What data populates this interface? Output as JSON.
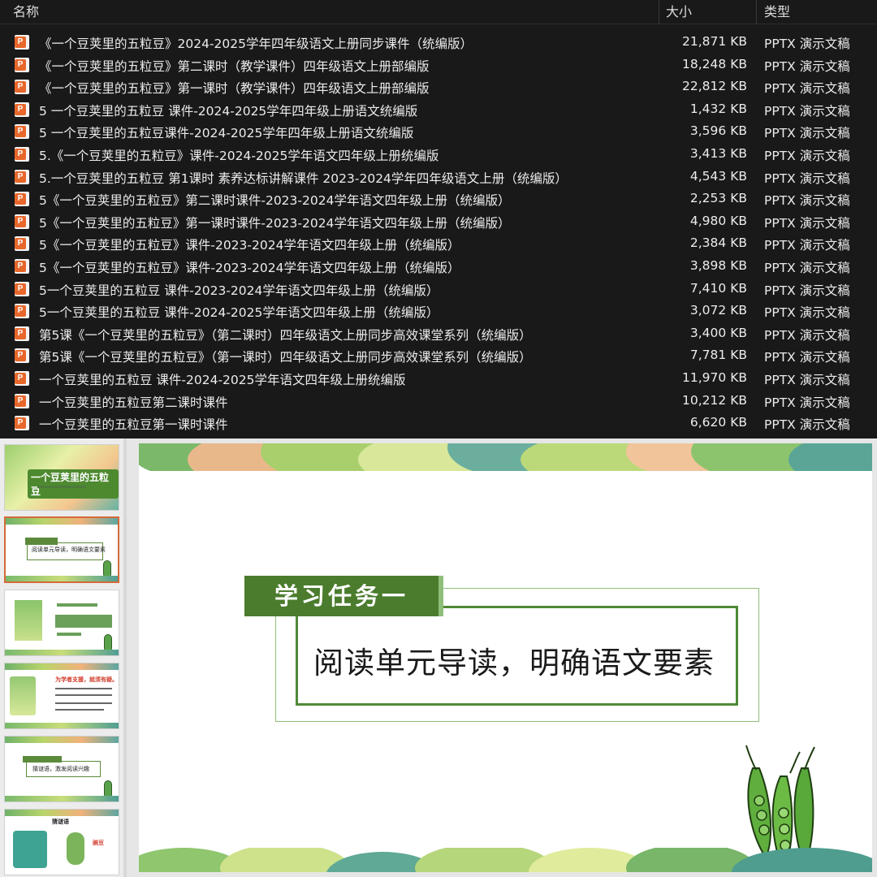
{
  "explorer": {
    "columns": {
      "name": "名称",
      "size": "大小",
      "type": "类型"
    },
    "file_icon": "pptx-file-icon",
    "file_icon_letter": "P",
    "files": [
      {
        "name": "《一个豆荚里的五粒豆》2024-2025学年四年级语文上册同步课件（统编版）",
        "size": "21,871 KB",
        "type": "PPTX 演示文稿"
      },
      {
        "name": "《一个豆荚里的五粒豆》第二课时（教学课件）四年级语文上册部编版",
        "size": "18,248 KB",
        "type": "PPTX 演示文稿"
      },
      {
        "name": "《一个豆荚里的五粒豆》第一课时（教学课件）四年级语文上册部编版",
        "size": "22,812 KB",
        "type": "PPTX 演示文稿"
      },
      {
        "name": "5 一个豆荚里的五粒豆 课件-2024-2025学年四年级上册语文统编版",
        "size": "1,432 KB",
        "type": "PPTX 演示文稿"
      },
      {
        "name": "5 一个豆荚里的五粒豆课件-2024-2025学年四年级上册语文统编版",
        "size": "3,596 KB",
        "type": "PPTX 演示文稿"
      },
      {
        "name": "5.《一个豆荚里的五粒豆》课件-2024-2025学年语文四年级上册统编版",
        "size": "3,413 KB",
        "type": "PPTX 演示文稿"
      },
      {
        "name": "5.一个豆荚里的五粒豆 第1课时 素养达标讲解课件 2023-2024学年四年级语文上册（统编版）",
        "size": "4,543 KB",
        "type": "PPTX 演示文稿"
      },
      {
        "name": "5《一个豆荚里的五粒豆》第二课时课件-2023-2024学年语文四年级上册（统编版）",
        "size": "2,253 KB",
        "type": "PPTX 演示文稿"
      },
      {
        "name": "5《一个豆荚里的五粒豆》第一课时课件-2023-2024学年语文四年级上册（统编版）",
        "size": "4,980 KB",
        "type": "PPTX 演示文稿"
      },
      {
        "name": "5《一个豆荚里的五粒豆》课件-2023-2024学年语文四年级上册（统编版）",
        "size": "2,384 KB",
        "type": "PPTX 演示文稿"
      },
      {
        "name": "5《一个豆荚里的五粒豆》课件-2023-2024学年语文四年级上册（统编版）",
        "size": "3,898 KB",
        "type": "PPTX 演示文稿"
      },
      {
        "name": "5一个豆荚里的五粒豆 课件-2023-2024学年语文四年级上册（统编版）",
        "size": "7,410 KB",
        "type": "PPTX 演示文稿"
      },
      {
        "name": "5一个豆荚里的五粒豆 课件-2024-2025学年语文四年级上册（统编版）",
        "size": "3,072 KB",
        "type": "PPTX 演示文稿"
      },
      {
        "name": "第5课《一个豆荚里的五粒豆》（第二课时）四年级语文上册同步高效课堂系列（统编版）",
        "size": "3,400 KB",
        "type": "PPTX 演示文稿"
      },
      {
        "name": "第5课《一个豆荚里的五粒豆》（第一课时）四年级语文上册同步高效课堂系列（统编版）",
        "size": "7,781 KB",
        "type": "PPTX 演示文稿"
      },
      {
        "name": "一个豆荚里的五粒豆 课件-2024-2025学年语文四年级上册统编版",
        "size": "11,970 KB",
        "type": "PPTX 演示文稿"
      },
      {
        "name": "一个豆荚里的五粒豆第二课时课件",
        "size": "10,212 KB",
        "type": "PPTX 演示文稿"
      },
      {
        "name": "一个豆荚里的五粒豆第一课时课件",
        "size": "6,620 KB",
        "type": "PPTX 演示文稿"
      }
    ]
  },
  "thumbnails": {
    "t1_title": "一个豆荚里的五粒豆",
    "t2_text": "阅读单元导读，明确语文要素",
    "t4_red": "为学者支援，就须有疑。",
    "t5_text": "猜谜语，激发阅读兴趣",
    "t6_title": "猜谜语",
    "t6_answer": "豌豆"
  },
  "slide": {
    "task_label": "学习任务一",
    "task_text": "阅读单元导读，明确语文要素"
  },
  "colors": {
    "explorer_bg": "#191919",
    "accent_green": "#4b7c2d",
    "pptx_orange": "#e8672b",
    "selected_thumb_border": "#d46a3a"
  }
}
